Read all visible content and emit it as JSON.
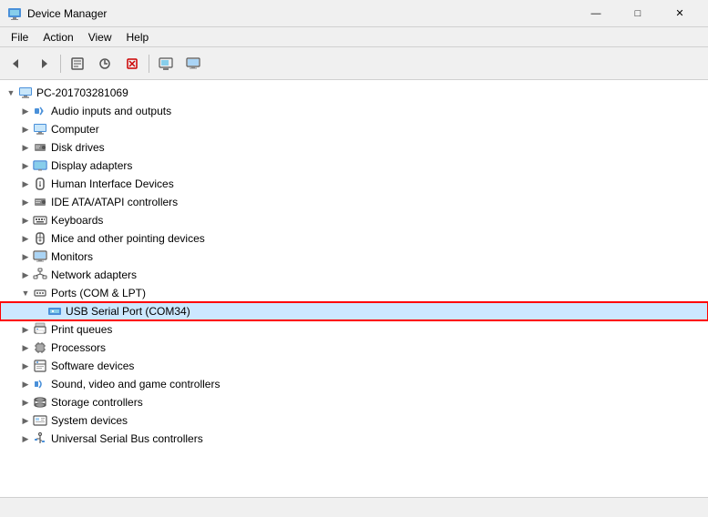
{
  "titleBar": {
    "icon": "device-manager-icon",
    "title": "Device Manager",
    "minimize": "—",
    "maximize": "□",
    "close": "✕"
  },
  "menuBar": {
    "items": [
      "File",
      "Action",
      "View",
      "Help"
    ]
  },
  "toolbar": {
    "buttons": [
      "back",
      "forward",
      "properties",
      "update",
      "uninstall",
      "scan",
      "monitor"
    ]
  },
  "tree": {
    "root": {
      "label": "PC-201703281069",
      "expanded": true
    },
    "items": [
      {
        "id": "audio",
        "label": "Audio inputs and outputs",
        "indent": 1,
        "type": "audio",
        "expanded": false
      },
      {
        "id": "computer",
        "label": "Computer",
        "indent": 1,
        "type": "computer",
        "expanded": false
      },
      {
        "id": "disk",
        "label": "Disk drives",
        "indent": 1,
        "type": "disk",
        "expanded": false
      },
      {
        "id": "display",
        "label": "Display adapters",
        "indent": 1,
        "type": "display",
        "expanded": false
      },
      {
        "id": "hid",
        "label": "Human Interface Devices",
        "indent": 1,
        "type": "hid",
        "expanded": false
      },
      {
        "id": "ide",
        "label": "IDE ATA/ATAPI controllers",
        "indent": 1,
        "type": "ide",
        "expanded": false
      },
      {
        "id": "keyboards",
        "label": "Keyboards",
        "indent": 1,
        "type": "keyboard",
        "expanded": false
      },
      {
        "id": "mice",
        "label": "Mice and other pointing devices",
        "indent": 1,
        "type": "mice",
        "expanded": false
      },
      {
        "id": "monitors",
        "label": "Monitors",
        "indent": 1,
        "type": "monitor",
        "expanded": false
      },
      {
        "id": "network",
        "label": "Network adapters",
        "indent": 1,
        "type": "network",
        "expanded": false
      },
      {
        "id": "ports",
        "label": "Ports (COM & LPT)",
        "indent": 1,
        "type": "ports",
        "expanded": true
      },
      {
        "id": "usb-serial",
        "label": "USB Serial Port (COM34)",
        "indent": 2,
        "type": "usb-serial",
        "expanded": false,
        "highlighted": true
      },
      {
        "id": "print",
        "label": "Print queues",
        "indent": 1,
        "type": "print",
        "expanded": false
      },
      {
        "id": "processors",
        "label": "Processors",
        "indent": 1,
        "type": "processor",
        "expanded": false
      },
      {
        "id": "software",
        "label": "Software devices",
        "indent": 1,
        "type": "software",
        "expanded": false
      },
      {
        "id": "sound",
        "label": "Sound, video and game controllers",
        "indent": 1,
        "type": "sound",
        "expanded": false
      },
      {
        "id": "storage",
        "label": "Storage controllers",
        "indent": 1,
        "type": "storage",
        "expanded": false
      },
      {
        "id": "system",
        "label": "System devices",
        "indent": 1,
        "type": "system",
        "expanded": false
      },
      {
        "id": "usb",
        "label": "Universal Serial Bus controllers",
        "indent": 1,
        "type": "usb",
        "expanded": false
      }
    ]
  },
  "statusBar": {
    "text": ""
  }
}
